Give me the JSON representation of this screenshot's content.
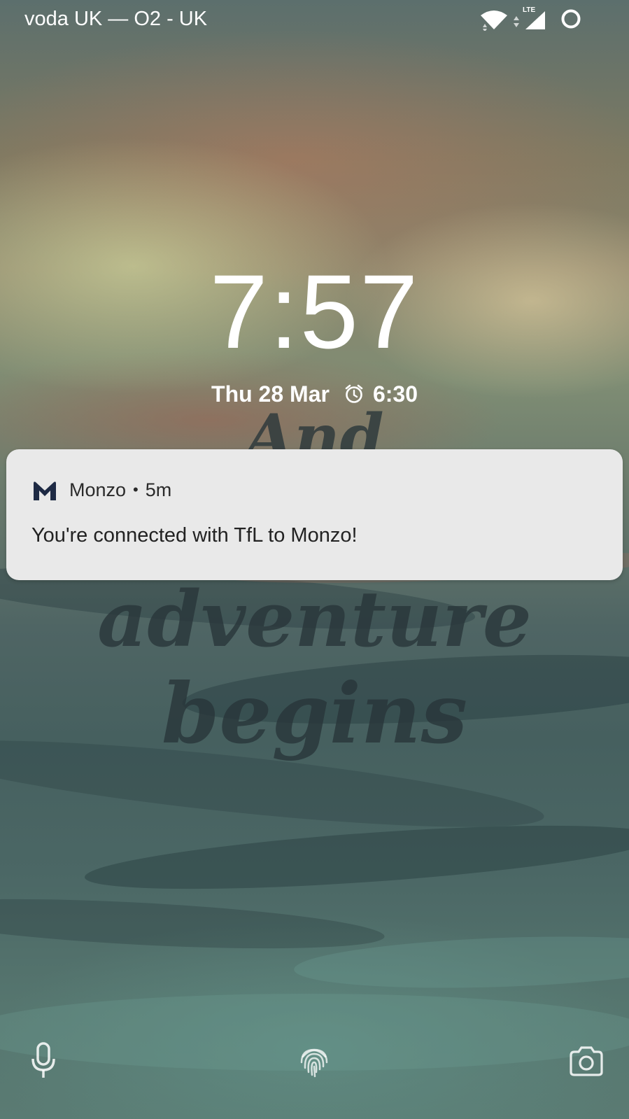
{
  "status_bar": {
    "carrier": "voda UK — O2 - UK",
    "network_type": "LTE",
    "icons": [
      "wifi-icon",
      "signal-icon",
      "battery-ring-icon"
    ]
  },
  "lock_screen": {
    "time": "7:57",
    "date": "Thu 28 Mar",
    "alarm_time": "6:30"
  },
  "wallpaper": {
    "lettering": [
      "And",
      "adventure",
      "begins"
    ]
  },
  "notification": {
    "app_name": "Monzo",
    "separator": "•",
    "time_ago": "5m",
    "message": "You're connected with TfL to Monzo!",
    "icon": "monzo-logo-icon"
  },
  "bottom_shortcuts": [
    "microphone-icon",
    "fingerprint-icon",
    "camera-icon"
  ]
}
